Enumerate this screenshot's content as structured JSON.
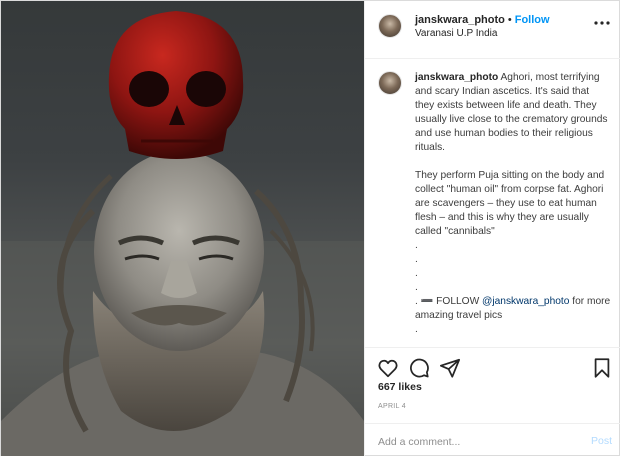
{
  "post": {
    "username": "janskwara_photo",
    "follow_label": "Follow",
    "separator": "•",
    "location": "Varanasi U.P India"
  },
  "caption": {
    "username": "janskwara_photo",
    "paragraph1": "Aghori, most terrifying and scary Indian ascetics. It's said that they exists between life and death. They usually live close to the crematory grounds and use human bodies to their religious rituals.",
    "paragraph2": "They perform Puja sitting on the body and collect \"human oil\" from corpse fat. Aghori are scavengers – they use to eat human flesh – and this is why they are usually called \"cannibals\"",
    "dots": [
      ".",
      ".",
      ".",
      "."
    ],
    "follow_prefix": ". ➖ FOLLOW ",
    "mention": "@janskwara_photo",
    "follow_suffix": " for more amazing travel pics",
    "last_dot": "."
  },
  "stats": {
    "likes": "667 likes",
    "date": "APRIL 4"
  },
  "comment": {
    "placeholder": "Add a comment...",
    "post_label": "Post"
  },
  "icons": {
    "like": "heart-icon",
    "comment": "comment-icon",
    "share": "share-icon",
    "save": "bookmark-icon",
    "more": "more-options-icon"
  },
  "colors": {
    "accent": "#0095f6",
    "post_disabled": "#b3dbff",
    "muted": "#8e8e8e",
    "skull_red": "#8e1512"
  }
}
